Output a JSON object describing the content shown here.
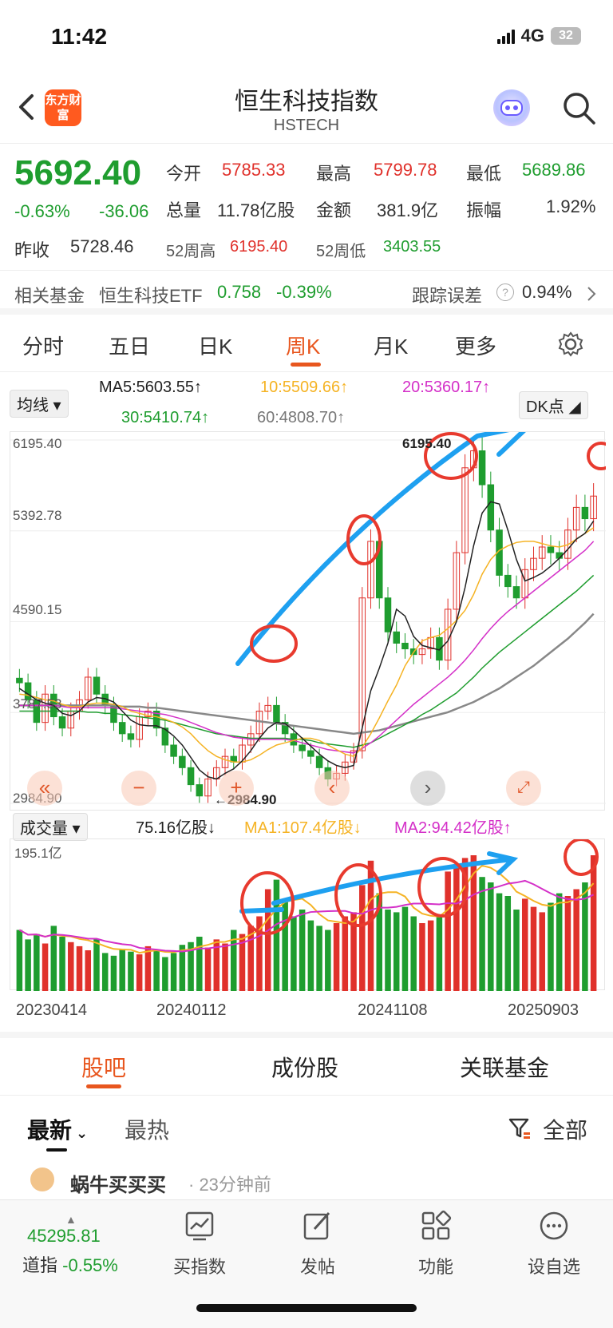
{
  "status": {
    "time": "11:42",
    "network": "4G",
    "battery": "32"
  },
  "header": {
    "title": "恒生科技指数",
    "subtitle": "HSTECH",
    "logo_text": "东方财富"
  },
  "quote": {
    "price": "5692.40",
    "change_pct": "-0.63%",
    "change": "-36.06",
    "open_label": "今开",
    "open": "5785.33",
    "high_label": "最高",
    "high": "5799.78",
    "low_label": "最低",
    "low": "5689.86",
    "volume_label": "总量",
    "volume": "11.78亿股",
    "amount_label": "金额",
    "amount": "381.9亿",
    "amplitude_label": "振幅",
    "amplitude": "1.92%",
    "prev_close_label": "昨收",
    "prev_close": "5728.46",
    "wk52_high_label": "52周高",
    "wk52_high": "6195.40",
    "wk52_low_label": "52周低",
    "wk52_low": "3403.55"
  },
  "fund": {
    "label": "相关基金",
    "name": "恒生科技ETF",
    "price": "0.758",
    "change": "-0.39%",
    "tracking_label": "跟踪误差",
    "tracking": "0.94%"
  },
  "tabs": [
    "分时",
    "五日",
    "日K",
    "周K",
    "月K",
    "更多"
  ],
  "active_tab": "周K",
  "ma": {
    "selector": "均线",
    "ma5": "MA5:5603.55↑",
    "ma10": "10:5509.66↑",
    "ma20": "20:5360.17↑",
    "ma30": "30:5410.74↑",
    "ma60": "60:4808.70↑",
    "dk": "DK点"
  },
  "colors": {
    "up": "#e0312b",
    "down": "#1f9d2f",
    "accent": "#e8561e",
    "ma5": "#222222",
    "ma10": "#f5b324",
    "ma20": "#d430c8",
    "ma30": "#1f9d2f",
    "ma60": "#888888",
    "annotation_blue": "#1ea0f0",
    "annotation_red": "#e83a2e"
  },
  "chart_data": {
    "type": "candlestick",
    "y_ticks": [
      "6195.40",
      "5392.78",
      "4590.15",
      "3787.53",
      "2984.90"
    ],
    "high_label": "6195.40",
    "low_label": "2984.90",
    "ylim": [
      2984.9,
      6195.4
    ],
    "closes": [
      4050,
      3900,
      3700,
      3950,
      3750,
      3650,
      3800,
      3900,
      4100,
      3950,
      3850,
      3700,
      3600,
      3550,
      3750,
      3800,
      3650,
      3500,
      3400,
      3300,
      3150,
      3050,
      3200,
      3300,
      3400,
      3350,
      3500,
      3600,
      3800,
      3850,
      3700,
      3600,
      3500,
      3450,
      3400,
      3300,
      3200,
      3250,
      3350,
      3450,
      4800,
      5300,
      4800,
      4500,
      4400,
      4350,
      4300,
      4350,
      4450,
      4250,
      4700,
      5200,
      5950,
      6100,
      5800,
      5400,
      5000,
      4900,
      4800,
      5050,
      5150,
      5250,
      5200,
      5150,
      5400,
      5600,
      5500,
      5700
    ],
    "ma5": [
      4000,
      3950,
      3900,
      3870,
      3850,
      3780,
      3760,
      3800,
      3880,
      3920,
      3910,
      3880,
      3800,
      3720,
      3680,
      3670,
      3670,
      3640,
      3580,
      3500,
      3390,
      3280,
      3220,
      3200,
      3250,
      3290,
      3360,
      3450,
      3560,
      3650,
      3700,
      3690,
      3630,
      3560,
      3490,
      3420,
      3360,
      3320,
      3300,
      3320,
      3650,
      3980,
      4180,
      4400,
      4700,
      4640,
      4460,
      4380,
      4360,
      4340,
      4420,
      4590,
      4890,
      5260,
      5550,
      5650,
      5630,
      5400,
      5140,
      4950,
      4980,
      5020,
      5080,
      5150,
      5230,
      5320,
      5370,
      5480
    ],
    "ma10": [
      3950,
      3940,
      3920,
      3900,
      3890,
      3860,
      3840,
      3840,
      3860,
      3870,
      3870,
      3860,
      3840,
      3800,
      3780,
      3760,
      3750,
      3730,
      3700,
      3660,
      3600,
      3520,
      3450,
      3400,
      3370,
      3350,
      3350,
      3370,
      3410,
      3460,
      3500,
      3520,
      3540,
      3560,
      3560,
      3540,
      3500,
      3460,
      3420,
      3400,
      3480,
      3600,
      3740,
      3890,
      4030,
      4200,
      4320,
      4420,
      4450,
      4470,
      4530,
      4600,
      4690,
      4830,
      5010,
      5140,
      5220,
      5260,
      5290,
      5300,
      5300,
      5280,
      5260,
      5250,
      5270,
      5320,
      5370,
      5420
    ],
    "ma20": [
      3850,
      3850,
      3850,
      3850,
      3850,
      3840,
      3830,
      3830,
      3830,
      3830,
      3830,
      3830,
      3820,
      3810,
      3800,
      3790,
      3780,
      3770,
      3750,
      3730,
      3700,
      3670,
      3640,
      3610,
      3590,
      3570,
      3560,
      3550,
      3550,
      3550,
      3550,
      3550,
      3540,
      3520,
      3500,
      3480,
      3460,
      3450,
      3440,
      3430,
      3470,
      3520,
      3580,
      3650,
      3720,
      3790,
      3860,
      3920,
      3980,
      4040,
      4100,
      4170,
      4250,
      4340,
      4440,
      4530,
      4610,
      4680,
      4740,
      4800,
      4860,
      4920,
      4980,
      5040,
      5100,
      5160,
      5220,
      5300
    ],
    "ma30": [
      3800,
      3800,
      3800,
      3800,
      3800,
      3800,
      3800,
      3800,
      3790,
      3790,
      3780,
      3780,
      3770,
      3760,
      3750,
      3740,
      3730,
      3720,
      3700,
      3680,
      3660,
      3640,
      3620,
      3600,
      3590,
      3580,
      3570,
      3560,
      3560,
      3560,
      3560,
      3560,
      3550,
      3550,
      3540,
      3520,
      3510,
      3500,
      3490,
      3480,
      3500,
      3520,
      3560,
      3600,
      3640,
      3680,
      3720,
      3770,
      3810,
      3860,
      3910,
      3960,
      4030,
      4100,
      4180,
      4250,
      4320,
      4380,
      4440,
      4500,
      4560,
      4620,
      4680,
      4740,
      4800,
      4860,
      4930,
      5000
    ],
    "ma60": [
      3850,
      3850,
      3850,
      3850,
      3850,
      3850,
      3850,
      3850,
      3850,
      3850,
      3850,
      3850,
      3840,
      3840,
      3840,
      3830,
      3830,
      3820,
      3810,
      3800,
      3790,
      3780,
      3770,
      3760,
      3750,
      3740,
      3730,
      3720,
      3710,
      3700,
      3690,
      3680,
      3670,
      3660,
      3650,
      3640,
      3630,
      3620,
      3610,
      3600,
      3610,
      3620,
      3630,
      3650,
      3670,
      3690,
      3710,
      3730,
      3750,
      3770,
      3790,
      3820,
      3850,
      3880,
      3920,
      3960,
      4000,
      4050,
      4100,
      4150,
      4200,
      4260,
      4320,
      4380,
      4440,
      4510,
      4580,
      4660
    ]
  },
  "volume": {
    "selector": "成交量",
    "value": "75.16亿股↓",
    "ma1": "MA1:107.4亿股↓",
    "ma2": "MA2:94.42亿股↑",
    "max_label": "195.1亿",
    "bars": [
      45,
      38,
      42,
      35,
      48,
      40,
      36,
      33,
      30,
      38,
      28,
      26,
      31,
      29,
      27,
      33,
      30,
      25,
      28,
      34,
      36,
      40,
      32,
      38,
      35,
      45,
      42,
      48,
      55,
      75,
      82,
      68,
      55,
      60,
      52,
      48,
      45,
      50,
      55,
      58,
      78,
      96,
      72,
      60,
      58,
      62,
      55,
      50,
      52,
      55,
      88,
      92,
      98,
      100,
      84,
      80,
      72,
      70,
      60,
      68,
      62,
      58,
      65,
      72,
      70,
      75,
      80,
      100
    ]
  },
  "dates": [
    "20230414",
    "20240112",
    "20241108",
    "20250903"
  ],
  "subtabs": [
    "股吧",
    "成份股",
    "关联基金"
  ],
  "filter": {
    "latest": "最新",
    "hot": "最热",
    "all": "全部"
  },
  "post": {
    "user": "蜗牛买买买",
    "time": "· 23分钟前"
  },
  "bottom": {
    "index_value": "45295.81",
    "index_name": "道指",
    "index_change": "-0.55%",
    "items": [
      "买指数",
      "发帖",
      "功能",
      "设自选"
    ]
  }
}
